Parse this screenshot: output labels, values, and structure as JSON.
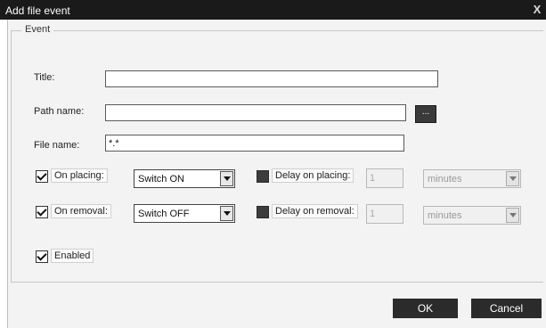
{
  "window": {
    "title": "Add file event",
    "close_glyph": "X"
  },
  "group": {
    "label": "Event"
  },
  "fields": {
    "title": {
      "label": "Title:",
      "value": ""
    },
    "path": {
      "label": "Path name:",
      "value": "",
      "browse_label": "..."
    },
    "file": {
      "label": "File name:",
      "value": "*.*"
    }
  },
  "on_placing": {
    "checked": true,
    "label": "On placing:",
    "action": "Switch ON",
    "delay_checked": false,
    "delay_label": "Delay on placing:",
    "delay_value": "1",
    "unit": "minutes"
  },
  "on_removal": {
    "checked": true,
    "label": "On removal:",
    "action": "Switch OFF",
    "delay_checked": false,
    "delay_label": "Delay on removal:",
    "delay_value": "1",
    "unit": "minutes"
  },
  "enabled": {
    "checked": true,
    "label": "Enabled"
  },
  "buttons": {
    "ok": "OK",
    "cancel": "Cancel"
  }
}
